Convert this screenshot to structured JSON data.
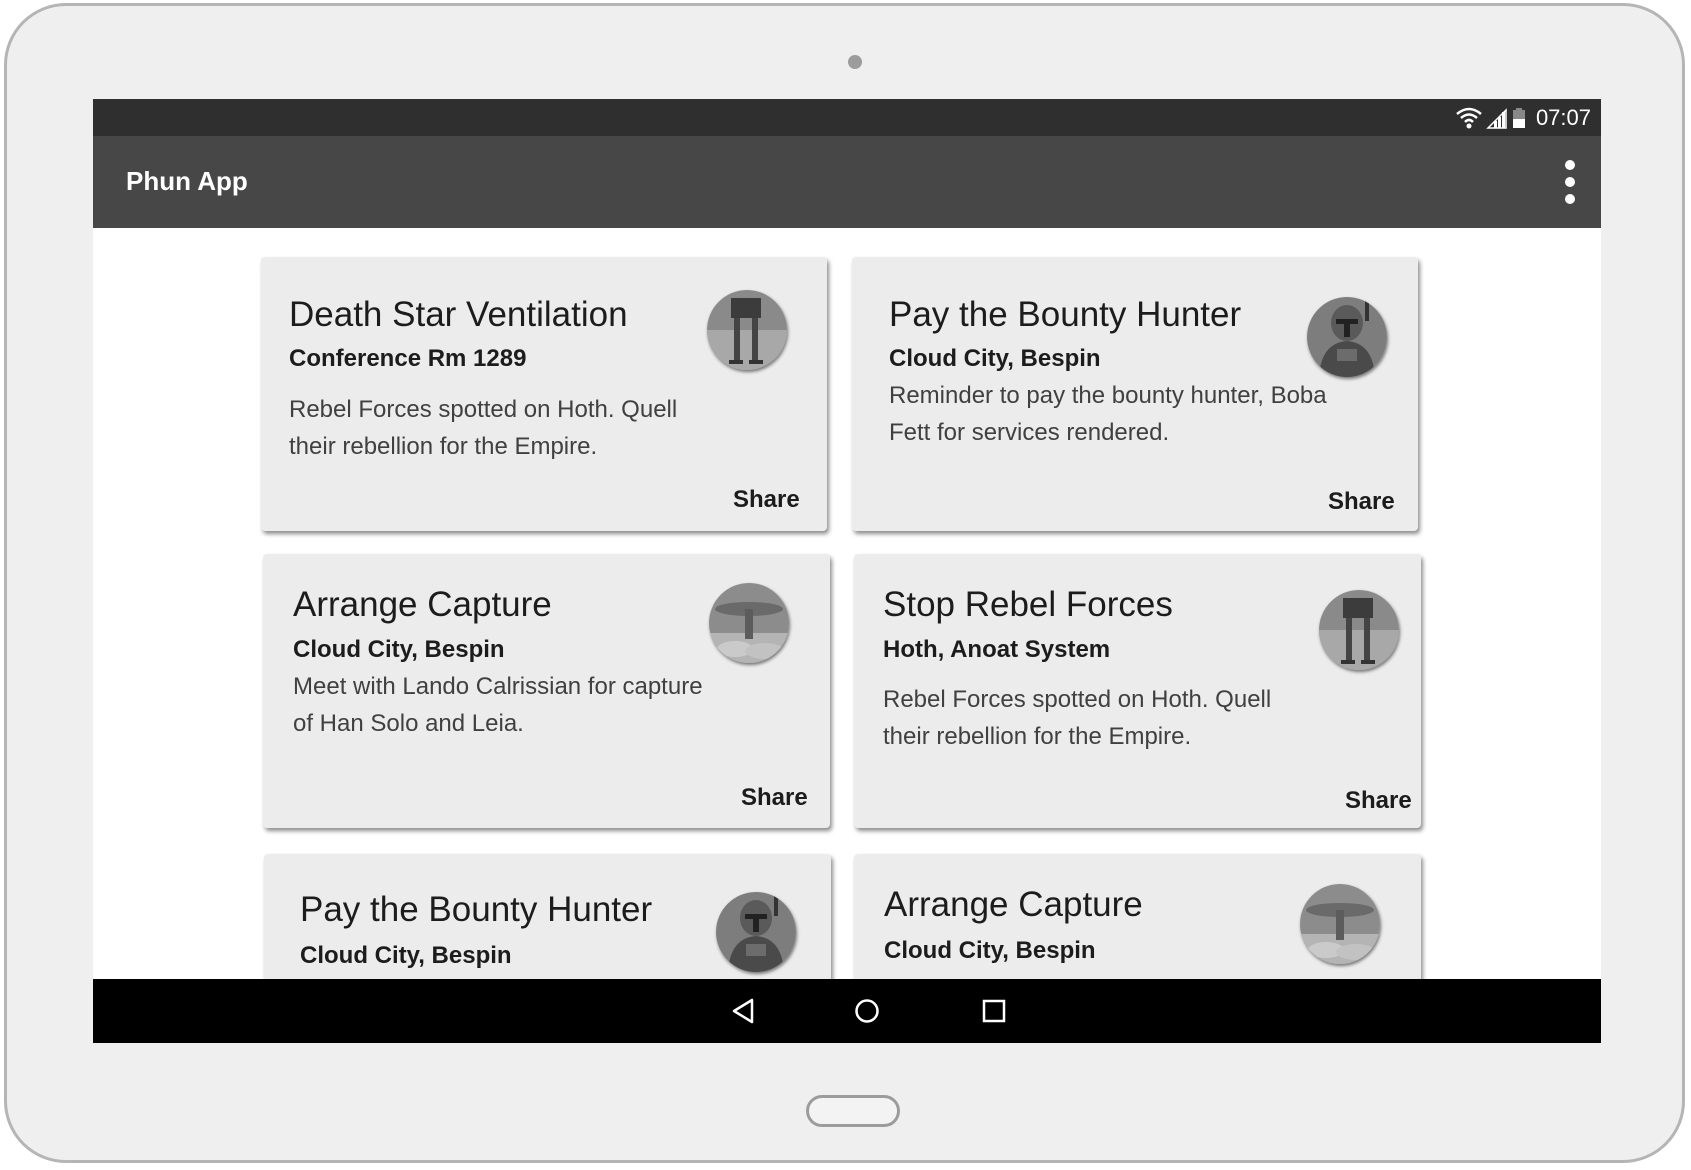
{
  "status_bar": {
    "time": "07:07",
    "icons": [
      "wifi-icon",
      "signal-icon",
      "battery-icon"
    ]
  },
  "app_bar": {
    "title": "Phun App",
    "menu_icon": "overflow-menu-icon"
  },
  "cards": [
    {
      "title": "Death Star Ventilation",
      "subtitle": "Conference Rm 1289",
      "body": "Rebel Forces spotted on Hoth. Quell their rebellion for the Empire.",
      "action": "Share",
      "avatar": "walker-avatar"
    },
    {
      "title": "Pay the Bounty Hunter",
      "subtitle": "Cloud City, Bespin",
      "body": "Reminder to pay the bounty hunter, Boba Fett for services rendered.",
      "action": "Share",
      "avatar": "bounty-hunter-avatar"
    },
    {
      "title": "Arrange Capture",
      "subtitle": "Cloud City, Bespin",
      "body": "Meet with Lando Calrissian for capture of Han Solo and Leia.",
      "action": "Share",
      "avatar": "cloud-city-avatar"
    },
    {
      "title": "Stop Rebel Forces",
      "subtitle": "Hoth, Anoat System",
      "body": "Rebel Forces spotted on Hoth. Quell their rebellion for the Empire.",
      "action": "Share",
      "avatar": "walker-avatar"
    },
    {
      "title": "Pay the Bounty Hunter",
      "subtitle": "Cloud City, Bespin",
      "avatar": "bounty-hunter-avatar"
    },
    {
      "title": "Arrange Capture",
      "subtitle": "Cloud City, Bespin",
      "avatar": "cloud-city-avatar"
    }
  ],
  "nav_bar": {
    "buttons": [
      "back-icon",
      "home-icon",
      "recents-icon"
    ]
  },
  "colors": {
    "status_bar": "#2f2f2f",
    "app_bar": "#474747",
    "card": "#ececec",
    "nav_bar": "#000000",
    "frame": "#efefef"
  }
}
